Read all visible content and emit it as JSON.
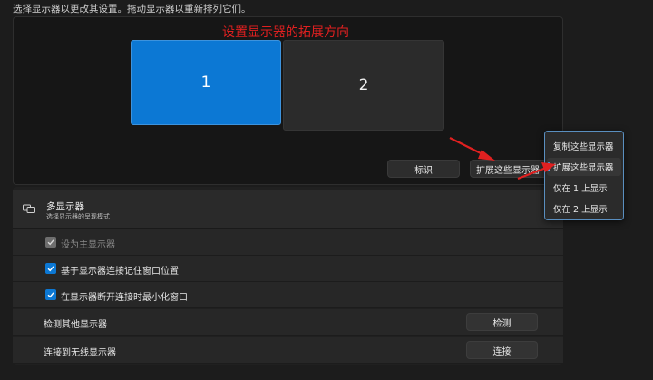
{
  "hint": "选择显示器以更改其设置。拖动显示器以重新排列它们。",
  "annotation": "设置显示器的拓展方向",
  "monitors": [
    {
      "label": "1",
      "selected": true
    },
    {
      "label": "2",
      "selected": false
    }
  ],
  "buttons": {
    "identify": "标识",
    "mode_select": "扩展这些显示器"
  },
  "dropdown": {
    "options": [
      "复制这些显示器",
      "扩展这些显示器",
      "仅在 1 上显示",
      "仅在 2 上显示"
    ],
    "selected": "扩展这些显示器"
  },
  "settings": {
    "title": "多显示器",
    "subtitle": "选择显示器的呈现模式",
    "primary_display": {
      "label": "设为主显示器",
      "checked": true,
      "disabled": true
    },
    "remember_positions": {
      "label": "基于显示器连接记住窗口位置",
      "checked": true
    },
    "minimize_on_disconnect": {
      "label": "在显示器断开连接时最小化窗口",
      "checked": true
    },
    "detect_other": {
      "label": "检测其他显示器",
      "button": "检测"
    },
    "connect_wireless": {
      "label": "连接到无线显示器",
      "button": "连接"
    }
  },
  "colors": {
    "accent": "#0c78d4",
    "annotation": "#e02020"
  },
  "icons": [
    "multi-monitor-icon",
    "checkmark-icon",
    "red-arrow-annotation"
  ]
}
